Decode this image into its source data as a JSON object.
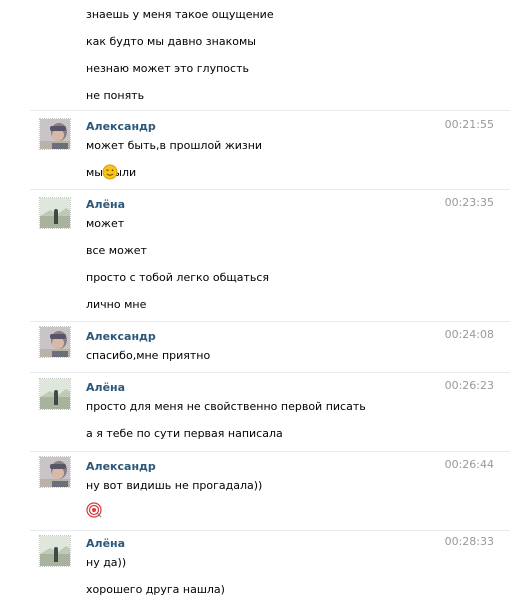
{
  "messages": {
    "m0": {
      "lines": [
        "знаешь у меня такое ощущение",
        "как будто мы давно знакомы",
        "незнаю может это глупость",
        "не понять"
      ]
    },
    "m1": {
      "author": "Александр",
      "time": "00:21:55",
      "lines": [
        "может быть,в прошлой жизни",
        "мы были"
      ],
      "emoji": "wink-emoji-icon"
    },
    "m2": {
      "author": "Алёна",
      "time": "00:23:35",
      "lines": [
        "может",
        "все может",
        "просто с тобой легко общаться",
        "лично мне"
      ]
    },
    "m3": {
      "author": "Александр",
      "time": "00:24:08",
      "lines": [
        "спасибо,мне приятно"
      ]
    },
    "m4": {
      "author": "Алёна",
      "time": "00:26:23",
      "lines": [
        "просто для меня не свойственно первой писать",
        "а я тебе по сути первая написала"
      ]
    },
    "m5": {
      "author": "Александр",
      "time": "00:26:44",
      "lines": [
        "ну вот видишь не прогадала))"
      ],
      "emoji": "target-emoji-icon"
    },
    "m6": {
      "author": "Алёна",
      "time": "00:28:33",
      "lines": [
        "ну да))",
        "хорошего друга нашла)"
      ]
    }
  },
  "colors": {
    "author": "#2b587a",
    "time": "#999999",
    "separator": "#e7ebf0"
  }
}
